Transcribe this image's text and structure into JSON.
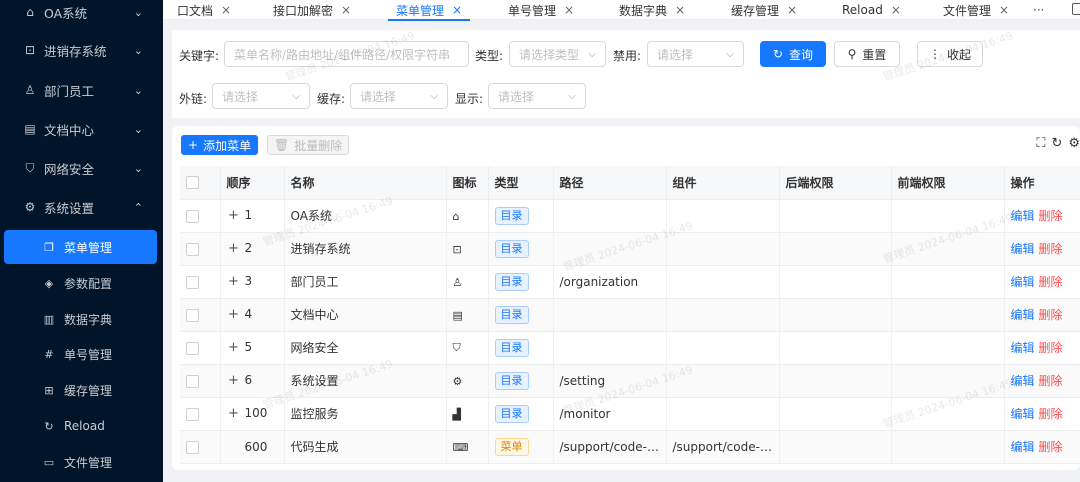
{
  "sidebar": {
    "items": [
      {
        "label": "OA系统",
        "icon": "home-icon",
        "glyph": "⌂"
      },
      {
        "label": "进销存系统",
        "icon": "store-icon",
        "glyph": "⊡"
      },
      {
        "label": "部门员工",
        "icon": "user-icon",
        "glyph": "♙"
      },
      {
        "label": "文档中心",
        "icon": "document-icon",
        "glyph": "▤"
      },
      {
        "label": "网络安全",
        "icon": "shield-icon",
        "glyph": "⛉"
      },
      {
        "label": "系统设置",
        "icon": "gear-icon",
        "glyph": "⚙"
      }
    ],
    "sub_items": [
      {
        "label": "菜单管理",
        "icon": "menu-doc-icon",
        "glyph": "❐"
      },
      {
        "label": "参数配置",
        "icon": "diamond-icon",
        "glyph": "◈"
      },
      {
        "label": "数据字典",
        "icon": "barcode-icon",
        "glyph": "▥"
      },
      {
        "label": "单号管理",
        "icon": "hash-icon",
        "glyph": "#"
      },
      {
        "label": "缓存管理",
        "icon": "grid-icon",
        "glyph": "⊞"
      },
      {
        "label": "Reload",
        "icon": "reload-icon",
        "glyph": "↻"
      },
      {
        "label": "文件管理",
        "icon": "folder-icon",
        "glyph": "▭"
      }
    ]
  },
  "tabs": [
    {
      "label": "口文档"
    },
    {
      "label": "接口加解密"
    },
    {
      "label": "菜单管理"
    },
    {
      "label": "单号管理"
    },
    {
      "label": "数据字典"
    },
    {
      "label": "缓存管理"
    },
    {
      "label": "Reload"
    },
    {
      "label": "文件管理"
    }
  ],
  "tab_more": "···",
  "filter": {
    "keyword_label": "关键字:",
    "keyword_placeholder": "菜单名称/路由地址/组件路径/权限字符串",
    "type_label": "类型:",
    "type_placeholder": "请选择类型",
    "disabled_label": "禁用:",
    "disabled_placeholder": "请选择",
    "external_label": "外链:",
    "external_placeholder": "请选择",
    "cache_label": "缓存:",
    "cache_placeholder": "请选择",
    "visible_label": "显示:",
    "visible_placeholder": "请选择",
    "query_label": "查询",
    "reset_label": "重置",
    "collapse_label": "收起"
  },
  "toolbar": {
    "add_label": "添加菜单",
    "batch_delete_label": "批量删除"
  },
  "table": {
    "headers": [
      "顺序",
      "名称",
      "图标",
      "类型",
      "路径",
      "组件",
      "后端权限",
      "前端权限",
      "操作"
    ],
    "edit_label": "编辑",
    "delete_label": "删除",
    "rows": [
      {
        "order": "1",
        "expandable": true,
        "name": "OA系统",
        "icon": "home-icon",
        "glyph": "⌂",
        "type": "目录",
        "kind": "dir",
        "path": "",
        "component": ""
      },
      {
        "order": "2",
        "expandable": true,
        "name": "进销存系统",
        "icon": "store-icon",
        "glyph": "⊡",
        "type": "目录",
        "kind": "dir",
        "path": "",
        "component": ""
      },
      {
        "order": "3",
        "expandable": true,
        "name": "部门员工",
        "icon": "user-icon",
        "glyph": "♙",
        "type": "目录",
        "kind": "dir",
        "path": "/organization",
        "component": ""
      },
      {
        "order": "4",
        "expandable": true,
        "name": "文档中心",
        "icon": "document-icon",
        "glyph": "▤",
        "type": "目录",
        "kind": "dir",
        "path": "",
        "component": ""
      },
      {
        "order": "5",
        "expandable": true,
        "name": "网络安全",
        "icon": "shield-icon",
        "glyph": "⛉",
        "type": "目录",
        "kind": "dir",
        "path": "",
        "component": ""
      },
      {
        "order": "6",
        "expandable": true,
        "name": "系统设置",
        "icon": "gear-icon",
        "glyph": "⚙",
        "type": "目录",
        "kind": "dir",
        "path": "/setting",
        "component": ""
      },
      {
        "order": "100",
        "expandable": true,
        "name": "监控服务",
        "icon": "chart-icon",
        "glyph": "▟",
        "type": "目录",
        "kind": "dir",
        "path": "/monitor",
        "component": ""
      },
      {
        "order": "600",
        "expandable": false,
        "name": "代码生成",
        "icon": "code-icon",
        "glyph": "⌨",
        "type": "菜单",
        "kind": "menu",
        "path": "/support/code-ge...",
        "component": "/support/code-ge..."
      }
    ]
  },
  "watermark": "管理员 2024-06-04 16:49",
  "colors": {
    "primary": "#1677ff",
    "danger": "#ff4d4f",
    "sidebar_bg": "#001529"
  }
}
